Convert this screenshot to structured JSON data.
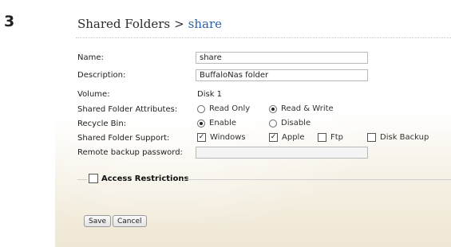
{
  "step_number": "3",
  "breadcrumb": {
    "parent": "Shared Folders",
    "separator": ">",
    "current": "share"
  },
  "form": {
    "name": {
      "label": "Name:",
      "value": "share"
    },
    "description": {
      "label": "Description:",
      "value": "BuffaloNas folder"
    },
    "volume": {
      "label": "Volume:",
      "value": "Disk 1"
    },
    "attributes": {
      "label": "Shared Folder Attributes:",
      "options": [
        {
          "label": "Read Only",
          "selected": false
        },
        {
          "label": "Read & Write",
          "selected": true
        }
      ]
    },
    "recycle_bin": {
      "label": "Recycle Bin:",
      "options": [
        {
          "label": "Enable",
          "selected": true
        },
        {
          "label": "Disable",
          "selected": false
        }
      ]
    },
    "support": {
      "label": "Shared Folder Support:",
      "options": [
        {
          "label": "Windows",
          "checked": true
        },
        {
          "label": "Apple",
          "checked": true
        },
        {
          "label": "Ftp",
          "checked": false
        },
        {
          "label": "Disk Backup",
          "checked": false
        }
      ]
    },
    "remote_password": {
      "label": "Remote backup password:",
      "value": ""
    }
  },
  "access_restrictions": {
    "label": "Access Restrictions",
    "checked": false
  },
  "buttons": {
    "save": "Save",
    "cancel": "Cancel"
  }
}
